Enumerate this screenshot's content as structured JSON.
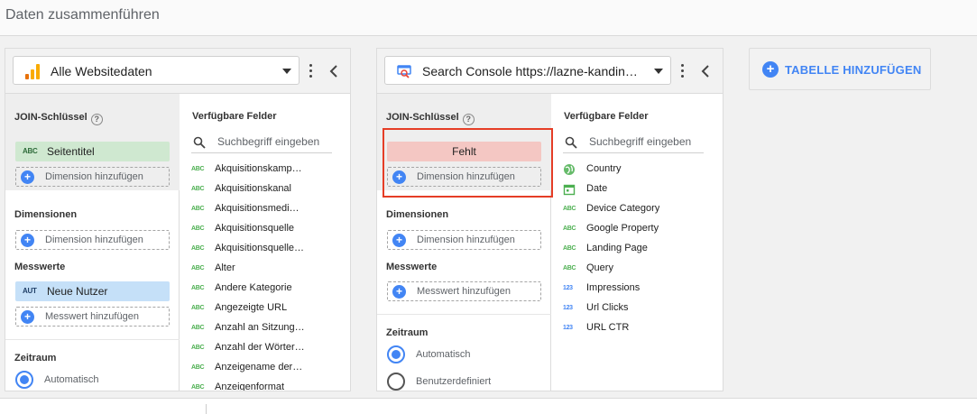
{
  "header": {
    "title": "Daten zusammenführen"
  },
  "panel1": {
    "source": "Alle Websitedaten",
    "join_label": "JOIN-Schlüssel",
    "join_chip": {
      "type": "ABC",
      "label": "Seitentitel"
    },
    "add_dimension": "Dimension hinzufügen",
    "dimensions_label": "Dimensionen",
    "metrics_label": "Messwerte",
    "metric_chip": {
      "type": "AUT",
      "label": "Neue Nutzer"
    },
    "add_metric": "Messwert hinzufügen",
    "date_range_label": "Zeitraum",
    "radio_auto": "Automatisch",
    "available_title": "Verfügbare Felder",
    "search_placeholder": "Suchbegriff eingeben",
    "fields": [
      {
        "type": "ABC",
        "name": "Akquisitionskamp…"
      },
      {
        "type": "ABC",
        "name": "Akquisitionskanal"
      },
      {
        "type": "ABC",
        "name": "Akquisitionsmedi…"
      },
      {
        "type": "ABC",
        "name": "Akquisitionsquelle"
      },
      {
        "type": "ABC",
        "name": "Akquisitionsquelle…"
      },
      {
        "type": "ABC",
        "name": "Alter"
      },
      {
        "type": "ABC",
        "name": "Andere Kategorie"
      },
      {
        "type": "ABC",
        "name": "Angezeigte URL"
      },
      {
        "type": "ABC",
        "name": "Anzahl an Sitzung…"
      },
      {
        "type": "ABC",
        "name": "Anzahl der Wörter …"
      },
      {
        "type": "ABC",
        "name": "Anzeigename der …"
      },
      {
        "type": "ABC",
        "name": "Anzeigenformat"
      }
    ]
  },
  "panel2": {
    "source": "Search Console https://lazne-kandin…",
    "join_label": "JOIN-Schlüssel",
    "join_missing": "Fehlt",
    "add_dimension": "Dimension hinzufügen",
    "dimensions_label": "Dimensionen",
    "metrics_label": "Messwerte",
    "add_metric": "Messwert hinzufügen",
    "date_range_label": "Zeitraum",
    "radio_auto": "Automatisch",
    "radio_custom": "Benutzerdefiniert",
    "available_title": "Verfügbare Felder",
    "search_placeholder": "Suchbegriff eingeben",
    "fields": [
      {
        "type": "geo",
        "name": "Country"
      },
      {
        "type": "date",
        "name": "Date"
      },
      {
        "type": "ABC",
        "name": "Device Category"
      },
      {
        "type": "ABC",
        "name": "Google Property"
      },
      {
        "type": "ABC",
        "name": "Landing Page"
      },
      {
        "type": "ABC",
        "name": "Query"
      },
      {
        "type": "123",
        "name": "Impressions"
      },
      {
        "type": "123",
        "name": "Url Clicks"
      },
      {
        "type": "123",
        "name": "URL CTR"
      }
    ]
  },
  "add_table": {
    "label": "TABELLE HINZUFÜGEN"
  },
  "colors": {
    "accent": "#4285f4",
    "highlight": "#e53d26",
    "join_missing_bg": "#f4c7c3",
    "dimension_chip": "#cfe8d0",
    "metric_chip": "#c5e0f8"
  },
  "icons": {
    "analytics": "analytics-icon",
    "search_console": "search-console-icon",
    "more": "more-vert-icon",
    "collapse": "chevron-left-icon",
    "search": "search-icon",
    "help": "help-icon",
    "add": "add-circle-icon",
    "globe": "globe-icon",
    "calendar": "calendar-icon"
  }
}
